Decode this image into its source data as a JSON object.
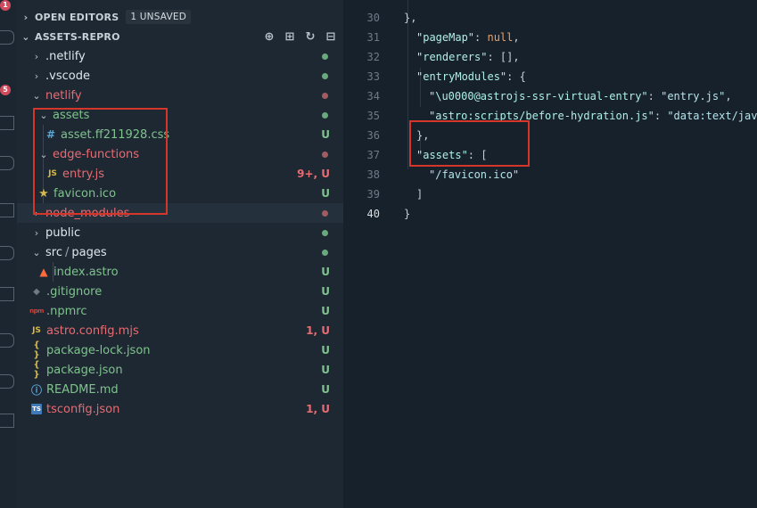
{
  "activitybar": {
    "badges": [
      "1",
      "5"
    ]
  },
  "sidebar": {
    "open_editors": {
      "label": "OPEN EDITORS",
      "badge": "1 UNSAVED"
    },
    "project": {
      "label": "ASSETS-REPRO"
    },
    "items": [
      {
        "label": ".netlify",
        "kind": "folder-closed",
        "status": "dot-green"
      },
      {
        "label": ".vscode",
        "kind": "folder-closed",
        "status": "dot-green"
      },
      {
        "label": "netlify",
        "kind": "folder-open",
        "status": "dot-red"
      },
      {
        "label": "assets",
        "kind": "folder-open",
        "status": "dot-green"
      },
      {
        "label": "asset.ff211928.css",
        "icon": "#",
        "status": "U"
      },
      {
        "label": "edge-functions",
        "kind": "folder-open",
        "status": "dot-red"
      },
      {
        "label": "entry.js",
        "icon": "JS",
        "status": "9+, U"
      },
      {
        "label": "favicon.ico",
        "icon": "★",
        "status": "U"
      },
      {
        "label": "node_modules",
        "kind": "folder-closed",
        "status": "dot-red"
      },
      {
        "label": "public",
        "kind": "folder-closed",
        "status": "dot-green"
      },
      {
        "label": "src",
        "label2": "pages",
        "kind": "folder-open",
        "status": "dot-green"
      },
      {
        "label": "index.astro",
        "icon": "astro-icon",
        "status": "U"
      },
      {
        "label": ".gitignore",
        "icon": "◆",
        "status": "U"
      },
      {
        "label": ".npmrc",
        "icon": "npm",
        "status": "U"
      },
      {
        "label": "astro.config.mjs",
        "icon": "JS",
        "status": "1, U"
      },
      {
        "label": "package-lock.json",
        "icon": "{ }",
        "status": "U"
      },
      {
        "label": "package.json",
        "icon": "{ }",
        "status": "U"
      },
      {
        "label": "README.md",
        "icon": "ⓘ",
        "status": "U"
      },
      {
        "label": "tsconfig.json",
        "icon": "TS",
        "status": "1, U"
      }
    ]
  },
  "editor": {
    "lines": [
      {
        "num": "30",
        "tokens": [
          [
            "p",
            "},"
          ]
        ]
      },
      {
        "num": "31",
        "tokens": [
          [
            "k",
            "\"pageMap\""
          ],
          [
            "p",
            ": "
          ],
          [
            "n",
            "null"
          ],
          [
            "p",
            ","
          ]
        ]
      },
      {
        "num": "32",
        "tokens": [
          [
            "k",
            "\"renderers\""
          ],
          [
            "p",
            ": [],"
          ]
        ]
      },
      {
        "num": "33",
        "tokens": [
          [
            "k",
            "\"entryModules\""
          ],
          [
            "p",
            ": {"
          ]
        ]
      },
      {
        "num": "34",
        "tokens": [
          [
            "k",
            "\"\\u0000@astrojs-ssr-virtual-entry\""
          ],
          [
            "p",
            ": "
          ],
          [
            "s",
            "\"entry.js\""
          ],
          [
            "p",
            ","
          ]
        ]
      },
      {
        "num": "35",
        "tokens": [
          [
            "k",
            "\"astro:scripts/before-hydration.js\""
          ],
          [
            "p",
            ": "
          ],
          [
            "s",
            "\"data:text/jav"
          ]
        ]
      },
      {
        "num": "36",
        "tokens": [
          [
            "p",
            "},"
          ]
        ]
      },
      {
        "num": "37",
        "tokens": [
          [
            "k",
            "\"assets\""
          ],
          [
            "p",
            ": ["
          ]
        ]
      },
      {
        "num": "38",
        "tokens": [
          [
            "s",
            "\"/favicon.ico\""
          ]
        ]
      },
      {
        "num": "39",
        "tokens": [
          [
            "p",
            "]"
          ]
        ]
      },
      {
        "num": "40",
        "tokens": [
          [
            "p",
            "}"
          ]
        ]
      }
    ]
  },
  "colors": {
    "sidebar_bg": "#1e2833",
    "editor_bg": "#17212b",
    "git_untracked": "#7fc38d",
    "git_error": "#e86b72",
    "highlight_box": "#d6352a"
  }
}
